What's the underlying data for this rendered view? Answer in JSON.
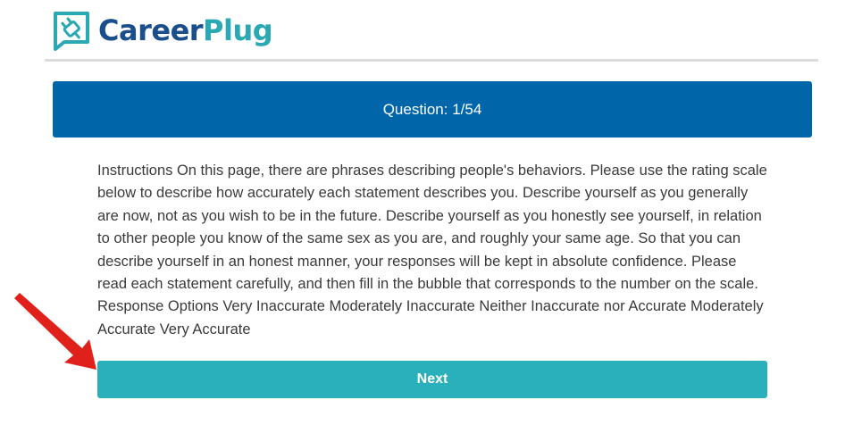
{
  "brand": {
    "name_part1": "Career",
    "name_part2": "Plug",
    "logo_icon": "plug-chat-bubble-icon",
    "color_primary": "#1a4f8b",
    "color_accent": "#2aa9b5"
  },
  "question_bar": {
    "label": "Question: 1/54",
    "color": "#0066a9"
  },
  "instructions": {
    "text": "Instructions On this page, there are phrases describing people's behaviors. Please use the rating scale below to describe how accurately each statement describes you. Describe yourself as you generally are now, not as you wish to be in the future. Describe yourself as you honestly see yourself, in relation to other people you know of the same sex as you are, and roughly your same age. So that you can describe yourself in an honest manner, your responses will be kept in absolute confidence. Please read each statement carefully, and then fill in the bubble that corresponds to the number on the scale. Response Options Very Inaccurate Moderately Inaccurate Neither Inaccurate nor Accurate Moderately Accurate Very Accurate"
  },
  "next_button": {
    "label": "Next",
    "color": "#2ab0ba"
  },
  "annotation": {
    "arrow_icon": "red-pointer-arrow-icon",
    "color": "#e0201b"
  }
}
